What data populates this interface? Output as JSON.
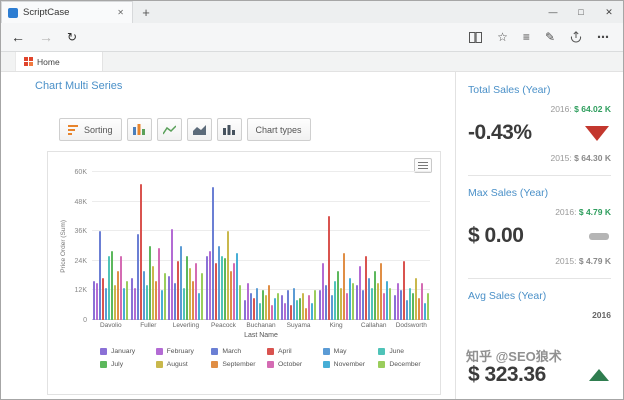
{
  "browser": {
    "tab_title": "ScriptCase",
    "tab_close_glyph": "✕",
    "new_tab_glyph": "+",
    "window_controls": {
      "minimize": "—",
      "maximize": "□",
      "close": "✕"
    },
    "nav": {
      "back": "←",
      "forward": "→",
      "refresh": "↻"
    },
    "icons": {
      "star": "☆",
      "hub": "≡",
      "note": "✎",
      "more": "⋯"
    }
  },
  "app": {
    "tab_label": "Home",
    "page_title": "Chart Multi Series",
    "toolbar": {
      "sorting_label": "Sorting",
      "chart_types_label": "Chart types"
    }
  },
  "theme": {
    "heading_blue": "#4a90c8",
    "positive_green": "#2f9e5e",
    "negative_red": "#c3372e",
    "neutral_gray": "#b5b5b5"
  },
  "chart_data": {
    "type": "bar",
    "title": "",
    "xlabel": "Last Name",
    "ylabel": "Price Order (Sum)",
    "ylim": [
      0,
      60000
    ],
    "yticks": [
      0,
      12000,
      24000,
      36000,
      48000,
      60000
    ],
    "ytick_labels": [
      "0",
      "12K",
      "24K",
      "36K",
      "48K",
      "60K"
    ],
    "grid": true,
    "legend_position": "bottom",
    "categories": [
      "Davolio",
      "Fuller",
      "Leverling",
      "Peacock",
      "Buchanan",
      "Suyama",
      "King",
      "Callahan",
      "Dodsworth"
    ],
    "series": [
      {
        "name": "January",
        "color": "#8a70d6",
        "values": [
          16000,
          17000,
          18000,
          26000,
          8000,
          10000,
          12000,
          14000,
          10000
        ]
      },
      {
        "name": "February",
        "color": "#b36bd4",
        "values": [
          15000,
          13000,
          37000,
          28000,
          15000,
          7000,
          23000,
          22000,
          15000
        ]
      },
      {
        "name": "March",
        "color": "#6b7fd4",
        "values": [
          36000,
          35000,
          15000,
          54000,
          11000,
          12000,
          14000,
          12000,
          12000
        ]
      },
      {
        "name": "April",
        "color": "#d9534f",
        "values": [
          17000,
          55000,
          24000,
          23000,
          9000,
          6000,
          42000,
          26000,
          24000
        ]
      },
      {
        "name": "May",
        "color": "#5b9bd5",
        "values": [
          13000,
          20000,
          30000,
          30000,
          13000,
          13000,
          10000,
          17000,
          8000
        ]
      },
      {
        "name": "June",
        "color": "#4fc3b8",
        "values": [
          26000,
          14000,
          13000,
          26000,
          7000,
          8000,
          16000,
          13000,
          13000
        ]
      },
      {
        "name": "July",
        "color": "#5cb85c",
        "values": [
          28000,
          30000,
          26000,
          25000,
          12000,
          9000,
          20000,
          20000,
          11000
        ]
      },
      {
        "name": "August",
        "color": "#c9b84c",
        "values": [
          14000,
          22000,
          21000,
          36000,
          10000,
          11000,
          13000,
          15000,
          17000
        ]
      },
      {
        "name": "September",
        "color": "#e08e45",
        "values": [
          20000,
          16000,
          16000,
          20000,
          14000,
          5000,
          27000,
          23000,
          9000
        ]
      },
      {
        "name": "October",
        "color": "#d46bb3",
        "values": [
          26000,
          29000,
          23000,
          23000,
          6000,
          10000,
          11000,
          11000,
          15000
        ]
      },
      {
        "name": "November",
        "color": "#46aed6",
        "values": [
          13000,
          12000,
          11000,
          27000,
          9000,
          7000,
          17000,
          16000,
          7000
        ]
      },
      {
        "name": "December",
        "color": "#9acd5c",
        "values": [
          16000,
          19000,
          19000,
          14000,
          11000,
          12000,
          15000,
          13000,
          11000
        ]
      }
    ]
  },
  "sidebar": {
    "panels": [
      {
        "title": "Total Sales (Year)",
        "top_label": "2016:",
        "top_value": "$ 64.02 K",
        "big_value": "-0.43%",
        "trend": "down",
        "bottom_label": "2015:",
        "bottom_value": "$ 64.30 K"
      },
      {
        "title": "Max Sales (Year)",
        "top_label": "2016:",
        "top_value": "$ 4.79 K",
        "big_value": "$ 0.00",
        "trend": "flat",
        "bottom_label": "2015:",
        "bottom_value": "$ 4.79 K"
      },
      {
        "title": "Avg Sales (Year)",
        "top_label": "2016",
        "big_value": "$ 323.36",
        "trend": "up"
      }
    ]
  },
  "watermark": "知乎 @SEO狼术"
}
